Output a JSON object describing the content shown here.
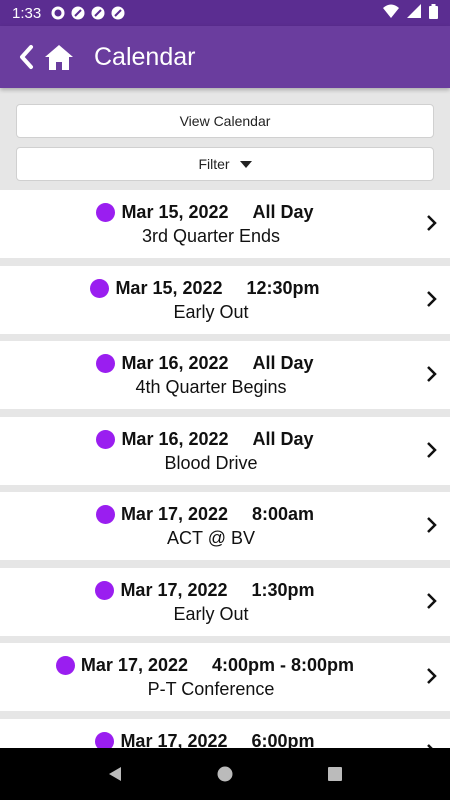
{
  "status_bar": {
    "time": "1:33"
  },
  "app_bar": {
    "title": "Calendar"
  },
  "buttons": {
    "view_calendar": "View Calendar",
    "filter": "Filter"
  },
  "events": [
    {
      "date": "Mar 15, 2022",
      "time": "All Day",
      "title": "3rd Quarter Ends"
    },
    {
      "date": "Mar 15, 2022",
      "time": "12:30pm",
      "title": "Early Out"
    },
    {
      "date": "Mar 16, 2022",
      "time": "All Day",
      "title": "4th Quarter Begins"
    },
    {
      "date": "Mar 16, 2022",
      "time": "All Day",
      "title": "Blood Drive"
    },
    {
      "date": "Mar 17, 2022",
      "time": "8:00am",
      "title": "ACT @ BV"
    },
    {
      "date": "Mar 17, 2022",
      "time": "1:30pm",
      "title": "Early Out"
    },
    {
      "date": "Mar 17, 2022",
      "time": "4:00pm - 8:00pm",
      "title": "P-T Conference"
    },
    {
      "date": "Mar 17, 2022",
      "time": "6:00pm",
      "title": ""
    }
  ],
  "colors": {
    "event_dot": "#9a1ef0",
    "app_bar": "#6a3d9e",
    "status_bar": "#5b2d91"
  }
}
